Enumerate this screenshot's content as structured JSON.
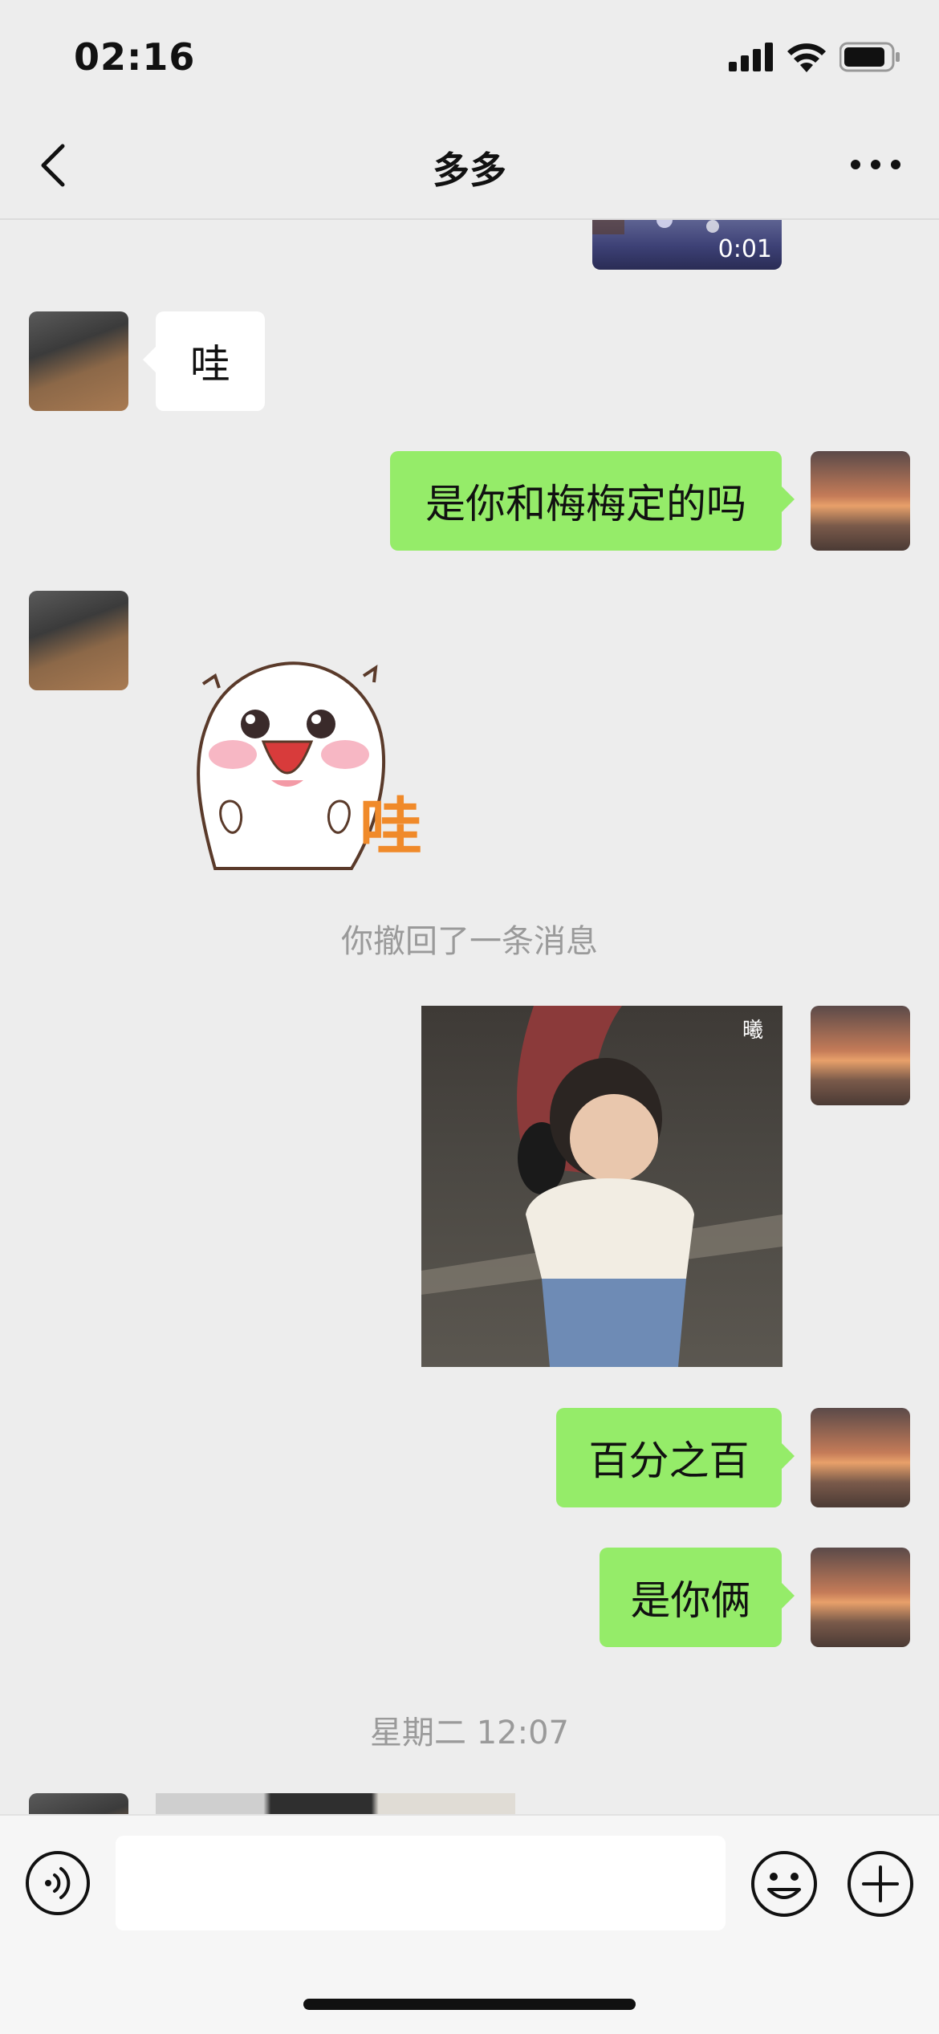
{
  "status_bar": {
    "time": "02:16"
  },
  "nav": {
    "title": "多多"
  },
  "messages": {
    "video_duration": "0:01",
    "m1_text": "哇",
    "m2_text": "是你和梅梅定的吗",
    "sticker_text": "哇",
    "recalled_notice": "你撤回了一条消息",
    "photo_watermark": "曦",
    "m5_text": "百分之百",
    "m6_text": "是你俩",
    "timestamp": "星期二 12:07"
  },
  "input": {
    "value": "",
    "placeholder": ""
  },
  "colors": {
    "outgoing_bubble": "#95ec69",
    "incoming_bubble": "#ffffff",
    "background": "#ededed"
  }
}
